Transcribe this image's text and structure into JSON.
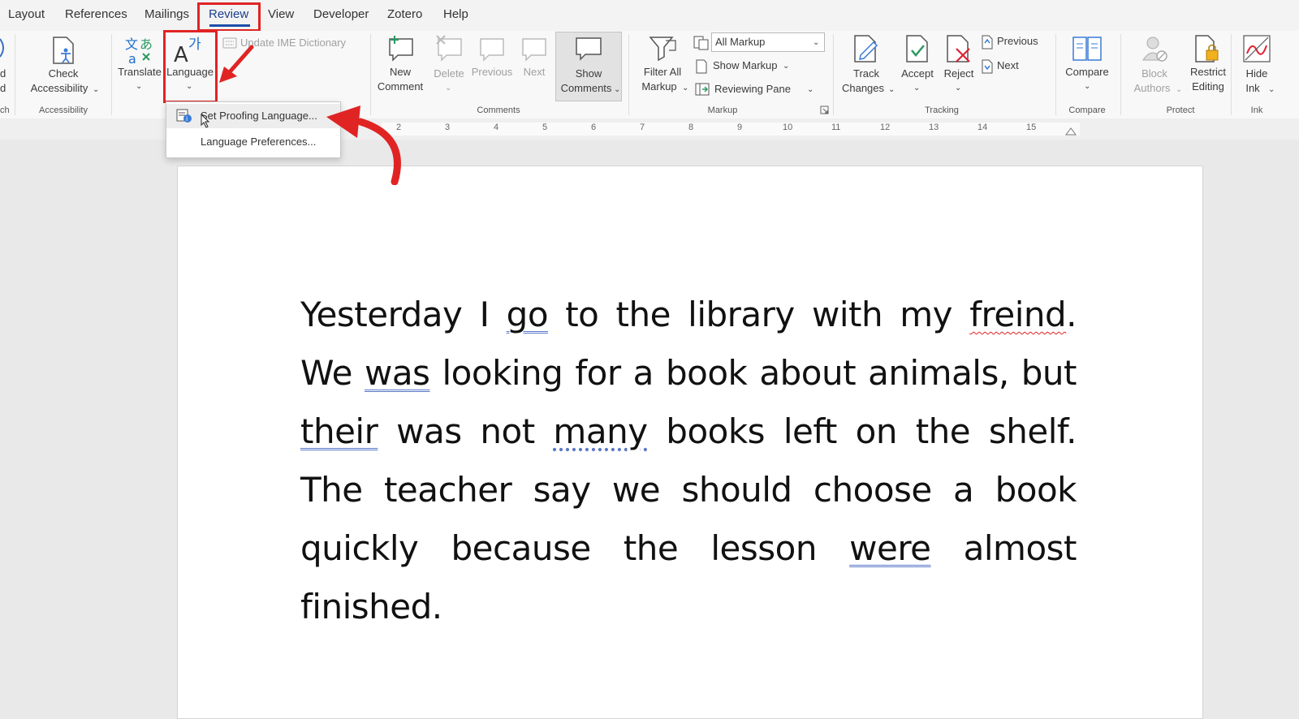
{
  "menu_tabs": [
    "Layout",
    "References",
    "Mailings",
    "Review",
    "View",
    "Developer",
    "Zotero",
    "Help"
  ],
  "ribbon": {
    "left_partial": [
      "d",
      "d",
      "ch"
    ],
    "check_accessibility": {
      "line1": "Check",
      "line2": "Accessibility"
    },
    "group_accessibility": "Accessibility",
    "translate": "Translate",
    "language": "Language",
    "update_ime": "Update IME Dictionary",
    "new_comment": {
      "line1": "New",
      "line2": "Comment"
    },
    "delete": "Delete",
    "previous": "Previous",
    "next": "Next",
    "show_comments": {
      "line1": "Show",
      "line2": "Comments"
    },
    "group_comments": "Comments",
    "filter_all_markup": {
      "line1": "Filter All",
      "line2": "Markup"
    },
    "markup_select": "All Markup",
    "show_markup": "Show Markup",
    "reviewing_pane": "Reviewing Pane",
    "group_markup": "Markup",
    "track_changes": {
      "line1": "Track",
      "line2": "Changes"
    },
    "accept": "Accept",
    "reject": "Reject",
    "tracking_previous": "Previous",
    "tracking_next": "Next",
    "group_tracking": "Tracking",
    "compare": "Compare",
    "group_compare": "Compare",
    "block_authors": {
      "line1": "Block",
      "line2": "Authors"
    },
    "restrict_editing": {
      "line1": "Restrict",
      "line2": "Editing"
    },
    "group_protect": "Protect",
    "hide_ink": {
      "line1": "Hide",
      "line2": "Ink"
    },
    "group_ink": "Ink"
  },
  "language_menu": {
    "set_proofing": "Set Proofing Language...",
    "preferences": "Language Preferences..."
  },
  "ruler": [
    "2",
    "3",
    "4",
    "5",
    "6",
    "7",
    "8",
    "9",
    "10",
    "11",
    "12",
    "13",
    "14",
    "15"
  ],
  "document": {
    "t1": "Yesterday I ",
    "e1": "go",
    "t2": " to the library with my ",
    "e2": "freind",
    "t3": ". We ",
    "e3": "was",
    "t4": " looking for a book about animals, but ",
    "e4": "their",
    "t5": " was not ",
    "e5": "many",
    "t6": " books left on the shelf. The teacher say we should choose a book quickly because the lesson ",
    "e6": "were",
    "t7": " almost finished."
  },
  "colors": {
    "highlight_box": "#e02424",
    "accent": "#1e4ea8"
  }
}
